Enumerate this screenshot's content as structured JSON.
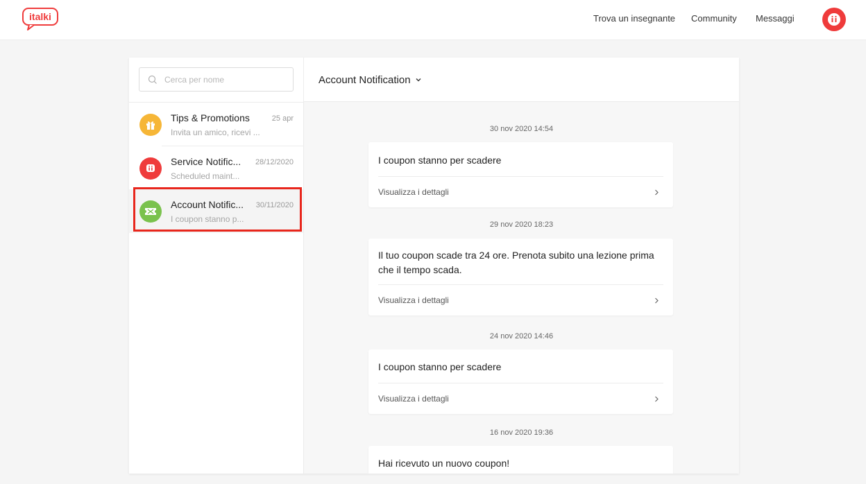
{
  "header": {
    "logo_text": "italki",
    "nav": [
      "Trova un insegnante",
      "Community",
      "Messaggi"
    ],
    "avatar_icon": "italki-avatar-icon",
    "brand_color": "#ef3b3b"
  },
  "sidebar": {
    "search_placeholder": "Cerca per nome",
    "conversations": [
      {
        "title": "Tips & Promotions",
        "date": "25 apr",
        "preview": "Invita un amico, ricevi ...",
        "icon": "gift-icon",
        "icon_color": "#f6b637",
        "selected": false
      },
      {
        "title": "Service Notific...",
        "date": "28/12/2020",
        "preview": "Scheduled maint...",
        "icon": "italki-icon",
        "icon_color": "#ef3b3b",
        "selected": false
      },
      {
        "title": "Account Notific...",
        "date": "30/11/2020",
        "preview": "I coupon stanno p...",
        "icon": "ticket-icon",
        "icon_color": "#7ac24d",
        "selected": true
      }
    ]
  },
  "main": {
    "title": "Account Notification",
    "messages": [
      {
        "time": "30 nov 2020 14:54",
        "text": "I coupon stanno per scadere",
        "link": "Visualizza i dettagli"
      },
      {
        "time": "29 nov 2020 18:23",
        "text": "Il tuo coupon scade tra 24 ore. Prenota subito una lezione prima che il tempo scada.",
        "link": "Visualizza i dettagli"
      },
      {
        "time": "24 nov 2020 14:46",
        "text": "I coupon stanno per scadere",
        "link": "Visualizza i dettagli"
      },
      {
        "time": "16 nov 2020 19:36",
        "text": "Hai ricevuto un nuovo coupon!",
        "link": ""
      }
    ]
  }
}
